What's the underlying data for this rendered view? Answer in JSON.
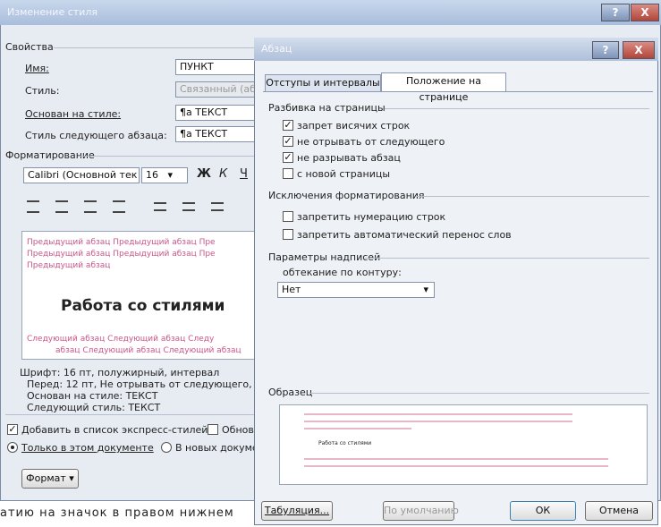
{
  "back_dialog": {
    "title": "Изменение стиля",
    "help": "?",
    "close": "X",
    "properties_heading": "Свойства",
    "name_label": "Имя:",
    "name_value": "ПУНКТ",
    "style_label": "Стиль:",
    "style_value": "Связанный (абзац",
    "based_on_label": "Основан на стиле:",
    "based_on_value": "¶a ТЕКСТ",
    "next_label": "Стиль следующего абзаца:",
    "next_value": "¶a ТЕКСТ",
    "formatting_heading": "Форматирование",
    "font_value": "Calibri (Основной тек",
    "size_value": "16",
    "bold": "Ж",
    "italic": "К",
    "underline": "Ч",
    "preview_prev_1": "Предыдущий абзац Предыдущий абзац Пре",
    "preview_prev_2": "Предыдущий абзац Предыдущий абзац Пре",
    "preview_prev_3": "Предыдущий абзац",
    "preview_sample": "Работа со стилями",
    "preview_next_1": "Следующий абзац Следующий абзац Следу",
    "preview_next_2": "абзац Следующий абзац Следующий абзац",
    "desc_1": "Шрифт: 16 пт, полужирный, интервал",
    "desc_2": "Перед:  12 пт, Не отрывать от следующего, Не р",
    "desc_3": "Основан на стиле: ТЕКСТ",
    "desc_4": "Следующий стиль: ТЕКСТ",
    "add_quick_label": "Добавить в список экспресс-стилей",
    "auto_update_label": "Обнов",
    "only_doc_label": "Только в этом документе",
    "new_docs_label": "В новых документ",
    "format_button": "Формат ▾"
  },
  "front_dialog": {
    "title": "Абзац",
    "help": "?",
    "close": "X",
    "tab_indents": "Отступы и интервалы",
    "tab_position": "Положение на странице",
    "pagination_heading": "Разбивка на страницы",
    "widow_label": "запрет висячих строк",
    "keep_next_label": "не отрывать от следующего",
    "keep_lines_label": "не разрывать абзац",
    "page_break_label": "с новой страницы",
    "exceptions_heading": "Исключения форматирования",
    "suppress_numbers_label": "запретить нумерацию строк",
    "no_hyphen_label": "запретить автоматический перенос слов",
    "textbox_heading": "Параметры надписей",
    "wrap_label": "обтекание по контуру:",
    "wrap_value": "Нет",
    "sample_heading": "Образец",
    "sample_text": "Работа со стилями",
    "tabs_button": "Табуляция...",
    "default_button": "По умолчанию",
    "ok_button": "ОК",
    "cancel_button": "Отмена"
  },
  "checkbox_states": {
    "widow": true,
    "keep_next": true,
    "keep_lines": true,
    "page_break": false,
    "suppress_numbers": false,
    "no_hyphen": false,
    "add_quick": true,
    "auto_update": false
  },
  "bottom_text": "атию на значок в правом нижнем"
}
